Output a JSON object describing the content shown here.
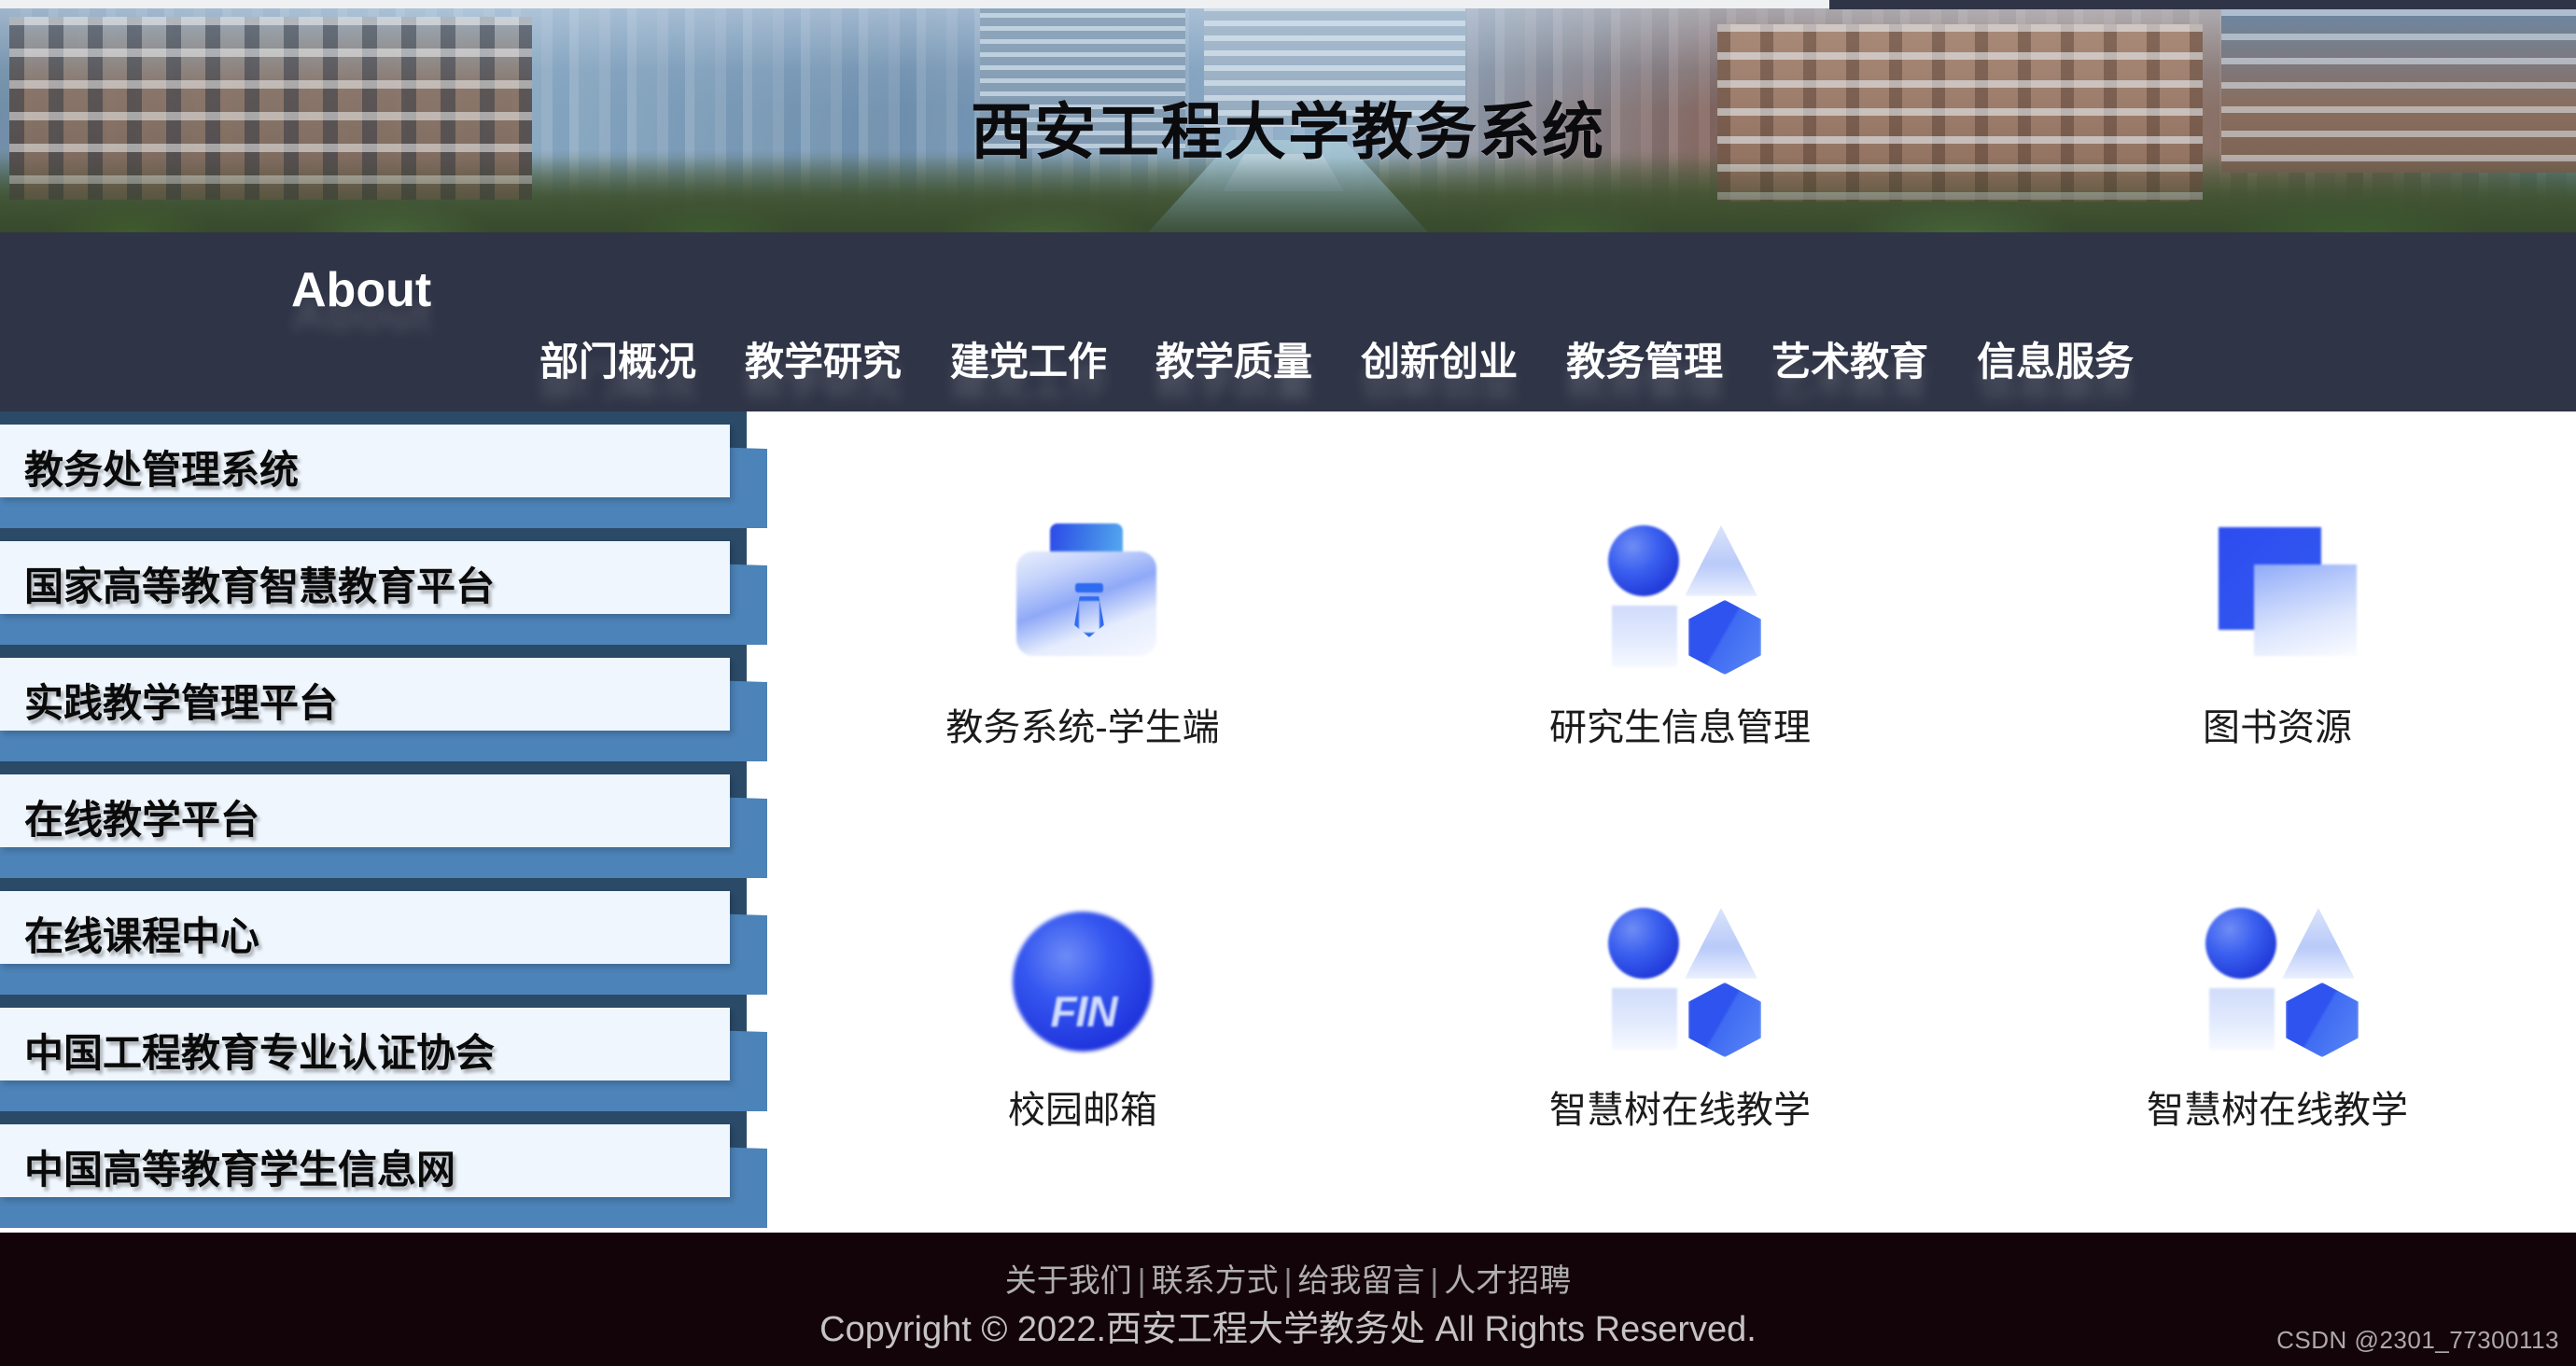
{
  "header": {
    "title": "西安工程大学教务系统",
    "banner_icon": "campus-photo"
  },
  "nav": {
    "about_label": "About",
    "items": [
      {
        "label": "部门概况"
      },
      {
        "label": "教学研究"
      },
      {
        "label": "建党工作"
      },
      {
        "label": "教学质量"
      },
      {
        "label": "创新创业"
      },
      {
        "label": "教务管理"
      },
      {
        "label": "艺术教育"
      },
      {
        "label": "信息服务"
      }
    ]
  },
  "sidebar": {
    "items": [
      {
        "label": "教务处管理系统"
      },
      {
        "label": "国家高等教育智慧教育平台"
      },
      {
        "label": "实践教学管理平台"
      },
      {
        "label": "在线教学平台"
      },
      {
        "label": "在线课程中心"
      },
      {
        "label": "中国工程教育专业认证协会"
      },
      {
        "label": "中国高等教育学生信息网"
      }
    ]
  },
  "main": {
    "tiles": [
      {
        "label": "教务系统-学生端",
        "icon": "briefcase-student-icon"
      },
      {
        "label": "研究生信息管理",
        "icon": "shapes-icon"
      },
      {
        "label": "图书资源",
        "icon": "stacked-squares-icon"
      },
      {
        "label": "校园邮箱",
        "icon": "mail-sphere-fin-icon",
        "icon_text": "FIN"
      },
      {
        "label": "智慧树在线教学",
        "icon": "shapes-icon"
      },
      {
        "label": "智慧树在线教学",
        "icon": "shapes-icon"
      }
    ]
  },
  "footer": {
    "links": [
      {
        "label": "关于我们"
      },
      {
        "label": "联系方式"
      },
      {
        "label": "给我留言"
      },
      {
        "label": "人才招聘"
      }
    ],
    "separator": "|",
    "copyright": "Copyright © 2022.西安工程大学教务处 All Rights Reserved.",
    "watermark": "CSDN @2301_77300113"
  },
  "colors": {
    "nav_bg": "#2f3446",
    "sidebar_blue": "#4c83b8",
    "sidebar_dark": "#2a4a68",
    "sidebar_face": "#eff6fd",
    "footer_bg": "#130409",
    "accent_blue": "#2f53ee"
  }
}
